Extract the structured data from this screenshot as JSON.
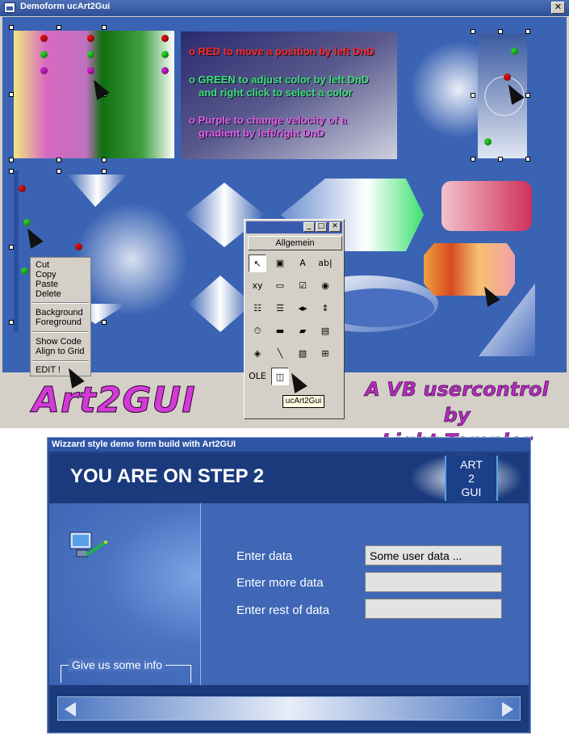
{
  "demo_window": {
    "title": "Demoform  ucArt2Gui",
    "close_glyph": "✕",
    "legend": {
      "red": "o RED to move a position by left DnD",
      "green_1": "o GREEN to adjust color by left DnD",
      "green_2": "and right click to select a color",
      "purple_1": "o Purple to change velocity of a",
      "purple_2": "gradient by left/right DnD"
    },
    "context_menu": {
      "items_1": [
        "Cut",
        "Copy",
        "Paste",
        "Delete"
      ],
      "items_2": [
        "Background",
        "Foreground"
      ],
      "items_3": [
        "Show Code",
        "Align to Grid"
      ],
      "items_4": [
        "EDIT !"
      ]
    },
    "toolbox": {
      "minimize": "_",
      "maximize": "□",
      "close": "✕",
      "tab_label": "Allgemein",
      "tooltip": "ucArt2Gui",
      "tools": [
        {
          "name": "pointer-tool-icon",
          "glyph": "↖"
        },
        {
          "name": "picturebox-tool-icon",
          "glyph": "▣"
        },
        {
          "name": "label-tool-icon",
          "glyph": "A"
        },
        {
          "name": "textbox-tool-icon",
          "glyph": "ab|"
        },
        {
          "name": "frame-tool-icon",
          "glyph": "xy"
        },
        {
          "name": "commandbutton-tool-icon",
          "glyph": "▭"
        },
        {
          "name": "checkbox-tool-icon",
          "glyph": "☑"
        },
        {
          "name": "optionbutton-tool-icon",
          "glyph": "◉"
        },
        {
          "name": "combobox-tool-icon",
          "glyph": "☷"
        },
        {
          "name": "listbox-tool-icon",
          "glyph": "☰"
        },
        {
          "name": "hscrollbar-tool-icon",
          "glyph": "◂▸"
        },
        {
          "name": "vscrollbar-tool-icon",
          "glyph": "⇕"
        },
        {
          "name": "timer-tool-icon",
          "glyph": "⏱"
        },
        {
          "name": "drivelistbox-tool-icon",
          "glyph": "▬"
        },
        {
          "name": "dirlistbox-tool-icon",
          "glyph": "▰"
        },
        {
          "name": "filelistbox-tool-icon",
          "glyph": "▤"
        },
        {
          "name": "shape-tool-icon",
          "glyph": "◈"
        },
        {
          "name": "line-tool-icon",
          "glyph": "╲"
        },
        {
          "name": "image-tool-icon",
          "glyph": "▧"
        },
        {
          "name": "data-tool-icon",
          "glyph": "⊞"
        },
        {
          "name": "ole-tool-icon",
          "glyph": "OLE"
        },
        {
          "name": "ucart2gui-tool-icon",
          "glyph": "◫"
        }
      ]
    }
  },
  "banner": {
    "logo": "Art2GUI",
    "subtitle_1": "A VB usercontrol by",
    "subtitle_2": "Light Templer"
  },
  "wizard": {
    "title": "Wizzard style demo form build with Art2GUI",
    "step_heading": "YOU ARE ON STEP 2",
    "badge_1": "ART",
    "badge_2": "2",
    "badge_3": "GUI",
    "group_label": "Give us some info",
    "fields": [
      {
        "label": "Enter data",
        "value": "Some user data ..."
      },
      {
        "label": "Enter more data",
        "value": ""
      },
      {
        "label": "Enter rest of data",
        "value": ""
      }
    ]
  },
  "colors": {
    "canvas_blue": "#3a63b3",
    "legend_red": "#ff2a2a",
    "legend_green": "#3be07a",
    "legend_purple": "#e060e8",
    "banner_magenta": "#d33ad8"
  }
}
